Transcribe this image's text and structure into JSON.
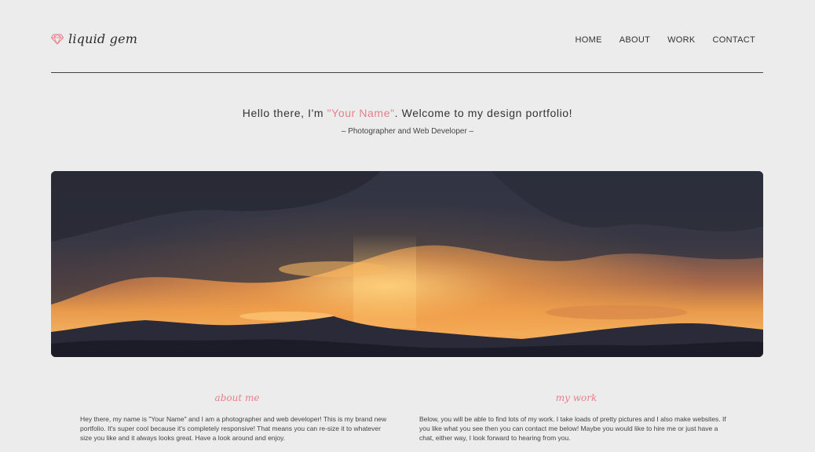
{
  "brand": {
    "name": "liquid gem",
    "icon": "gem-icon",
    "accent_color": "#e87f8a"
  },
  "nav": {
    "items": [
      "HOME",
      "ABOUT",
      "WORK",
      "CONTACT"
    ]
  },
  "hero": {
    "greeting_prefix": "Hello there, I'm ",
    "name": "\"Your Name\"",
    "greeting_suffix": ". Welcome to my design portfolio!",
    "subtitle": "– Photographer and Web Developer –"
  },
  "about": {
    "title": "about me",
    "text": "Hey there, my name is \"Your Name\" and I am a photographer and web developer! This is my brand new portfolio. It's super cool because it's completely responsive! That means you can re-size it to whatever size you like and it always looks great. Have a look around and enjoy."
  },
  "work": {
    "title": "my work",
    "text": "Below, you will be able to find lots of my work. I take loads of pretty pictures and I also make websites. If you like what you see then you can contact me below! Maybe you would like to hire me or just have a chat, either way, I look forward to hearing from you."
  }
}
